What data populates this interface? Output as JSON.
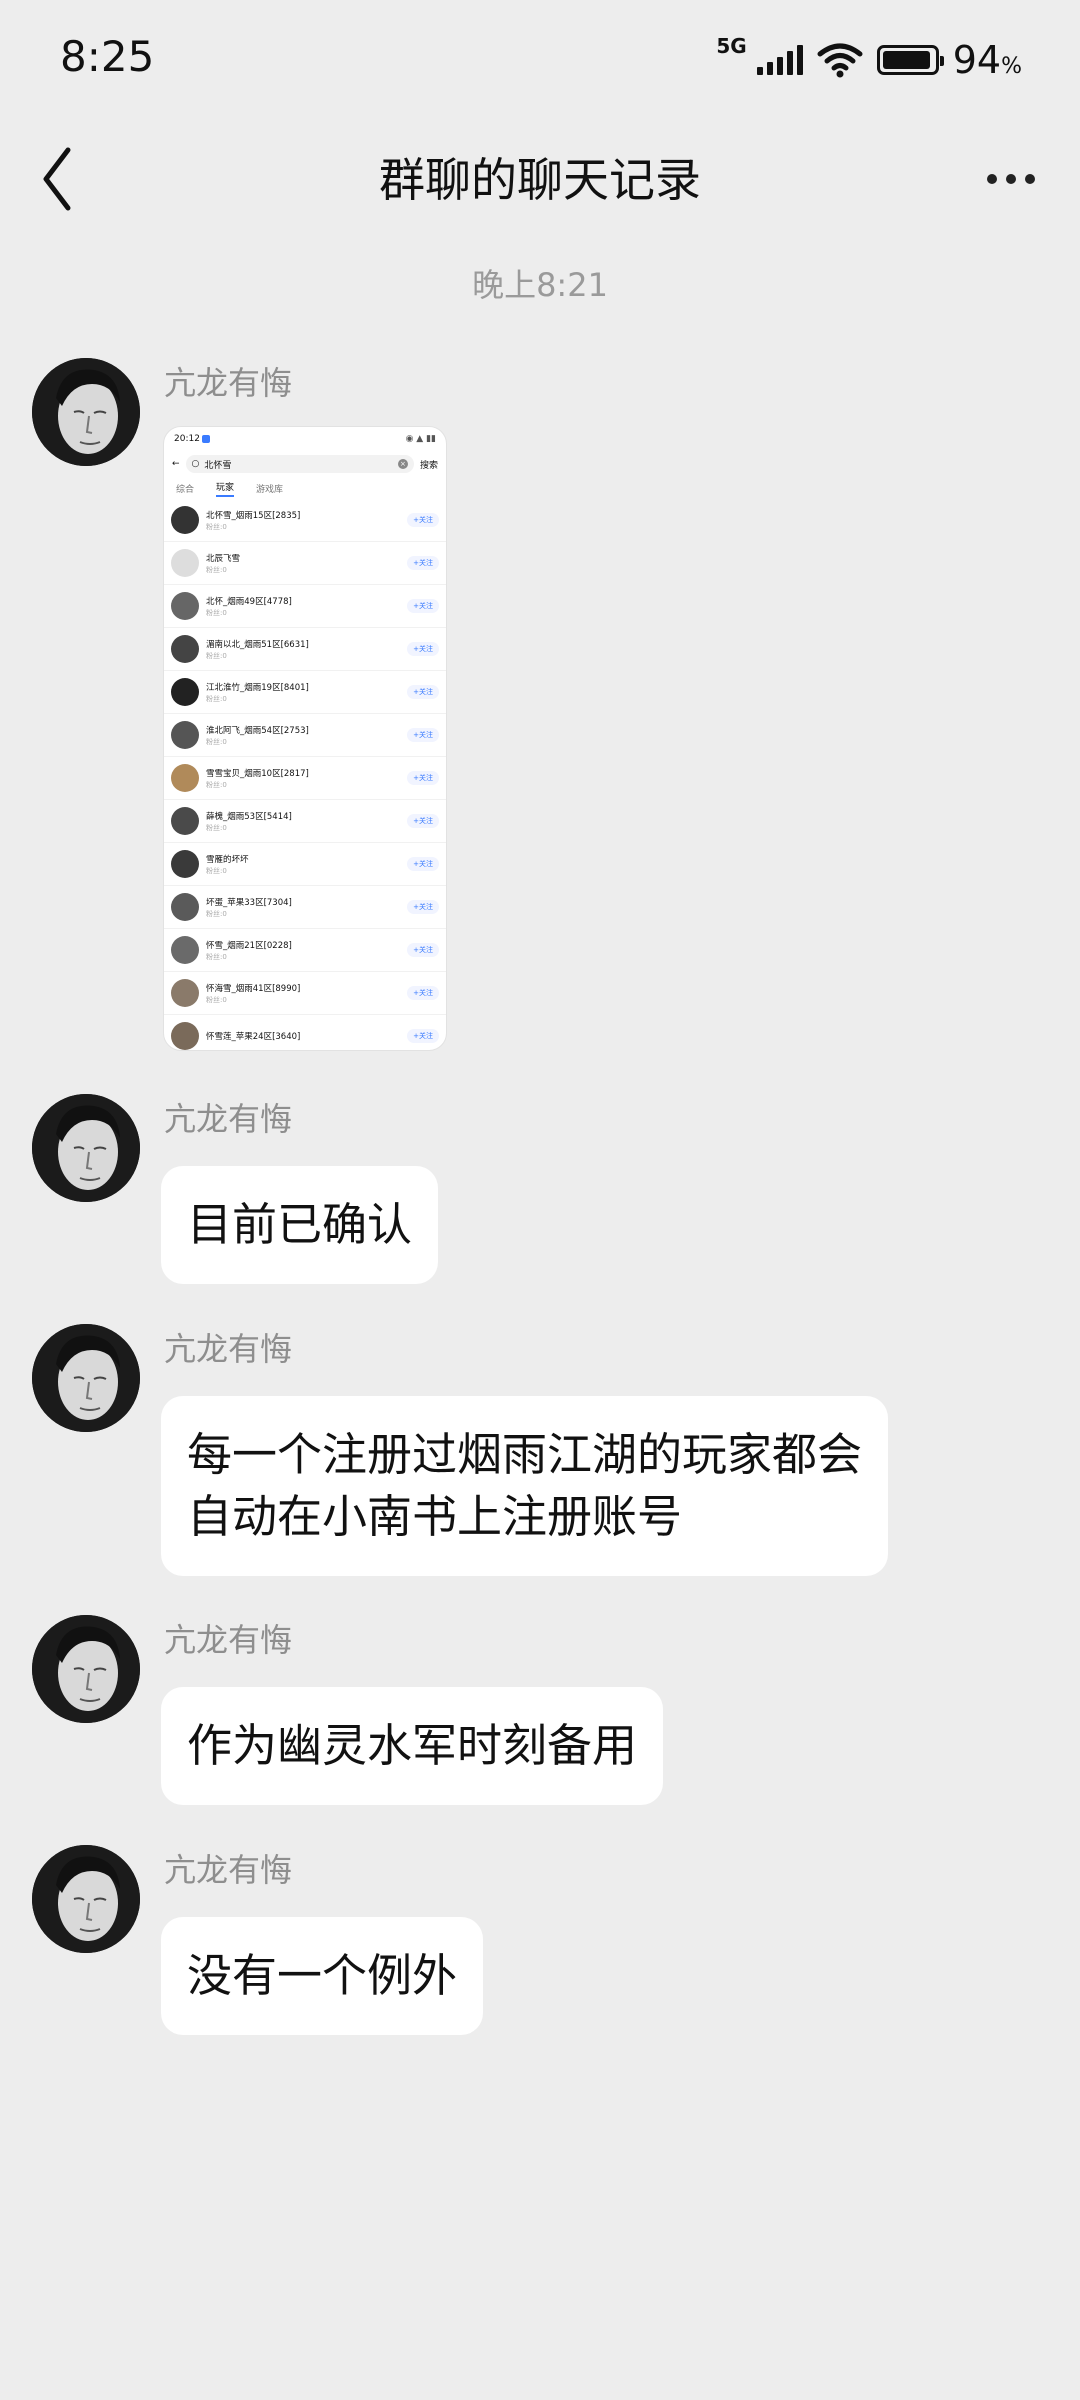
{
  "status_bar": {
    "time": "8:25",
    "network": "5G",
    "battery_percent": "94",
    "battery_unit": "%",
    "battery_level": 0.94,
    "icons": [
      "signal-icon",
      "wifi-icon",
      "battery-icon"
    ]
  },
  "header": {
    "title": "群聊的聊天记录",
    "back_icon": "chevron-left-icon",
    "more_icon": "more-dots-icon"
  },
  "chat": {
    "timestamp": "晚上8:21",
    "messages": [
      {
        "sender": "亢龙有悔",
        "type": "image",
        "screenshot": {
          "time": "20:12",
          "search_text": "北怀雪",
          "search_button": "搜索",
          "tabs": [
            "综合",
            "玩家",
            "游戏库"
          ],
          "active_tab": "玩家",
          "fans_label": "粉丝:0",
          "follow_label": "+关注",
          "rows": [
            "北怀雪_烟雨15区[2835]",
            "北辰飞雪",
            "北怀_烟雨49区[4778]",
            "湄南以北_烟雨51区[6631]",
            "江北淮竹_烟雨19区[8401]",
            "淮北阿飞_烟雨54区[2753]",
            "雪雪宝贝_烟雨10区[2817]",
            "薛槐_烟雨53区[5414]",
            "雪雁的坏坏",
            "坏蛋_苹果33区[7304]",
            "怀雪_烟雨21区[0228]",
            "怀海雪_烟雨41区[8990]",
            "怀雪莲_苹果24区[3640]"
          ]
        }
      },
      {
        "sender": "亢龙有悔",
        "type": "text",
        "text": "目前已确认"
      },
      {
        "sender": "亢龙有悔",
        "type": "text",
        "text": "每一个注册过烟雨江湖的玩家都会\n自动在小南书上注册账号"
      },
      {
        "sender": "亢龙有悔",
        "type": "text",
        "text": "作为幽灵水军时刻备用"
      },
      {
        "sender": "亢龙有悔",
        "type": "text",
        "text": "没有一个例外"
      }
    ]
  }
}
